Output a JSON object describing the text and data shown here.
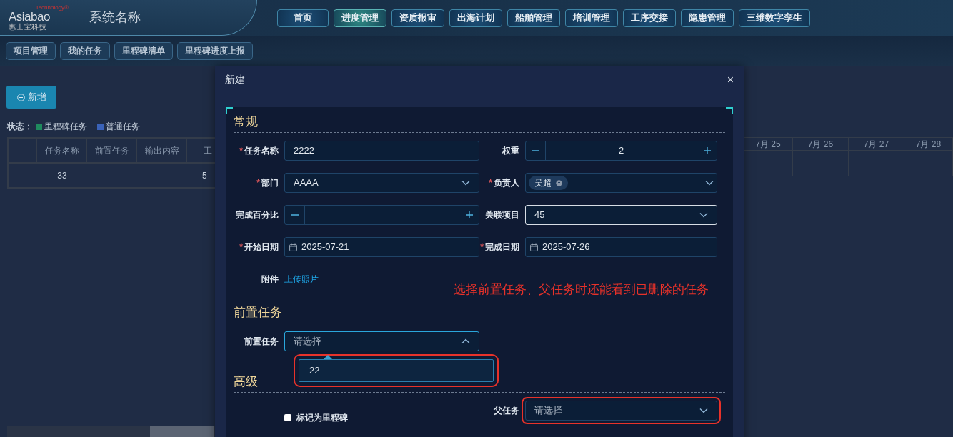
{
  "header": {
    "logo": {
      "mark": "Asiabao",
      "tagline": "Technology®",
      "subtitle": "惠 士 宝 科 技"
    },
    "system_name": "系统名称",
    "nav": [
      {
        "label": "首页",
        "selected": false
      },
      {
        "label": "进度管理",
        "selected": true
      },
      {
        "label": "资质报审",
        "selected": false
      },
      {
        "label": "出海计划",
        "selected": false
      },
      {
        "label": "船舶管理",
        "selected": false
      },
      {
        "label": "培训管理",
        "selected": false
      },
      {
        "label": "工序交接",
        "selected": false
      },
      {
        "label": "隐患管理",
        "selected": false
      },
      {
        "label": "三维数字孪生",
        "selected": false
      }
    ]
  },
  "subnav": [
    {
      "label": "项目管理"
    },
    {
      "label": "我的任务"
    },
    {
      "label": "里程碑清单"
    },
    {
      "label": "里程碑进度上报"
    }
  ],
  "toolbar": {
    "add_button": "新增"
  },
  "legend": {
    "label": "状态：",
    "items": [
      {
        "label": "里程碑任务",
        "color": "#1f8a5e"
      },
      {
        "label": "普通任务",
        "color": "#3a62b8"
      }
    ]
  },
  "table": {
    "columns": [
      "任务名称",
      "前置任务",
      "输出内容",
      "工"
    ],
    "rows": [
      {
        "task_name": "33",
        "column_4": "5"
      }
    ]
  },
  "gantt": {
    "dates": [
      "7月 25",
      "7月 26",
      "7月 27",
      "7月 28"
    ]
  },
  "dialog": {
    "title": "新建",
    "close": "×",
    "required_mark": "*",
    "sections": [
      {
        "title": "常规",
        "fields": [
          {
            "kind": "text",
            "label": "任务名称",
            "required": true,
            "value": "2222"
          },
          {
            "kind": "stepper",
            "label": "权重",
            "required": false,
            "value": "2"
          },
          {
            "kind": "select",
            "label": "部门",
            "required": true,
            "value": "AAAA",
            "focused": false
          },
          {
            "kind": "tags",
            "label": "负责人",
            "required": true,
            "tags": [
              "吴超"
            ]
          },
          {
            "kind": "stepper",
            "label": "完成百分比",
            "required": false
          },
          {
            "kind": "select",
            "label": "关联项目",
            "required": false,
            "value": "45",
            "focused": true
          },
          {
            "kind": "date",
            "label": "开始日期",
            "required": true,
            "value": "2025-07-21"
          },
          {
            "kind": "date",
            "label": "完成日期",
            "required": true,
            "value": "2025-07-26"
          },
          {
            "kind": "upload",
            "label": "附件",
            "required": false,
            "link": "上传照片"
          }
        ]
      },
      {
        "title": "前置任务",
        "fields": [
          {
            "kind": "select",
            "label": "前置任务",
            "required": false,
            "placeholder": "请选择",
            "focused": true,
            "open": true,
            "options": [
              "22"
            ],
            "highlighted": true
          }
        ]
      },
      {
        "title": "高级",
        "fields": [
          {
            "kind": "checkbox",
            "label": "标记为里程碑",
            "checked": false
          },
          {
            "kind": "select",
            "label": "父任务",
            "required": false,
            "placeholder": "请选择",
            "focused": false,
            "open": false,
            "highlighted": true
          }
        ]
      }
    ],
    "annotation": "选择前置任务、父任务时还能看到已删除的任务"
  }
}
